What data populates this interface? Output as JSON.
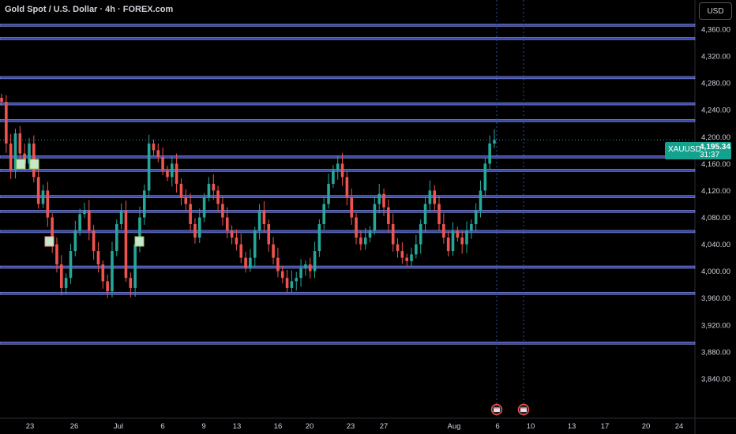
{
  "header": {
    "title": "Gold Spot / U.S. Dollar · 4h · FOREX.com",
    "currency_button": "USD"
  },
  "price_badge": {
    "symbol": "XAUUSD",
    "price": "4,195.34",
    "countdown": "31:37"
  },
  "colors": {
    "background": "#000000",
    "up": "#26a69a",
    "down": "#ef5350",
    "level_line": "#3f51b5",
    "badge": "#14a28f",
    "axis_text": "#d1d4dc"
  },
  "chart_data": {
    "type": "candlestick",
    "symbol": "XAUUSD",
    "timeframe": "4h",
    "ylim": [
      3800,
      4380
    ],
    "y_ticks": [
      "4,360.00",
      "4,320.00",
      "4,280.00",
      "4,240.00",
      "4,200.00",
      "4,160.00",
      "4,120.00",
      "4,080.00",
      "4,040.00",
      "4,000.00",
      "3,960.00",
      "3,920.00",
      "3,880.00",
      "3,840.00"
    ],
    "x_ticks": [
      "23",
      "26",
      "Jul",
      "6",
      "9",
      "13",
      "16",
      "20",
      "23",
      "27",
      "Aug",
      "6",
      "10",
      "13",
      "17",
      "20",
      "24"
    ],
    "current_price": 4195.34,
    "horizontal_levels": [
      4366,
      4346,
      4288,
      4249,
      4224,
      4170,
      4150,
      4111,
      4089,
      4059,
      4006,
      3967,
      3893
    ],
    "close_path": [
      4252,
      4190,
      4150,
      4205,
      4175,
      4160,
      4190,
      4140,
      4100,
      4120,
      4080,
      4040,
      4010,
      3975,
      3990,
      4030,
      4060,
      4085,
      4090,
      4060,
      4030,
      4010,
      3985,
      3970,
      4030,
      4070,
      4090,
      3990,
      3975,
      4040,
      4080,
      4120,
      4190,
      4180,
      4170,
      4150,
      4140,
      4160,
      4130,
      4110,
      4100,
      4070,
      4050,
      4080,
      4110,
      4130,
      4120,
      4100,
      4080,
      4060,
      4050,
      4040,
      4020,
      4005,
      4020,
      4060,
      4090,
      4070,
      4040,
      4020,
      4000,
      3990,
      3975,
      3985,
      3990,
      4005,
      4010,
      4000,
      4030,
      4070,
      4100,
      4130,
      4150,
      4160,
      4140,
      4110,
      4080,
      4050,
      4040,
      4050,
      4060,
      4100,
      4115,
      4095,
      4070,
      4040,
      4030,
      4020,
      4015,
      4025,
      4040,
      4070,
      4100,
      4120,
      4100,
      4070,
      4050,
      4030,
      4060,
      4050,
      4040,
      4060,
      4070,
      4090,
      4120,
      4160,
      4190,
      4195
    ]
  },
  "events": {
    "icons": [
      "event-flag-icon",
      "event-flag-icon"
    ]
  }
}
